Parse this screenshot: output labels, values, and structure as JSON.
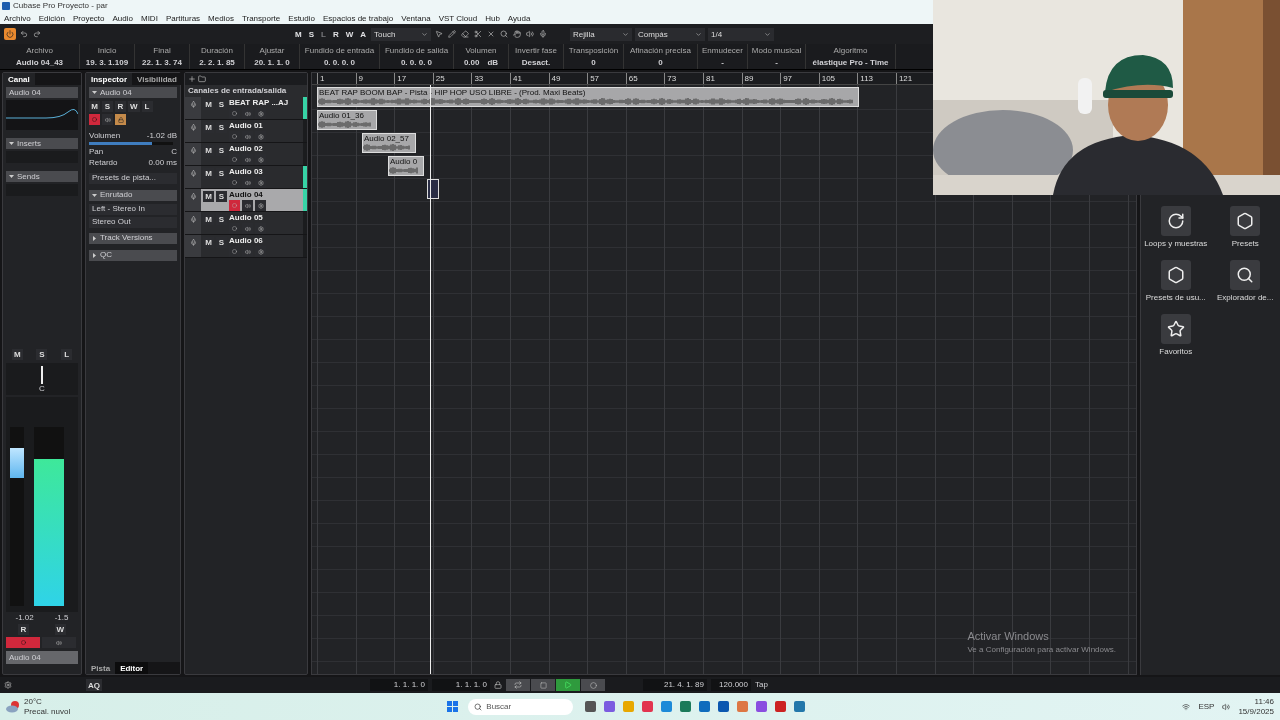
{
  "window": {
    "title": "Cubase Pro Proyecto - par"
  },
  "menu": [
    "Archivo",
    "Edición",
    "Proyecto",
    "Audio",
    "MIDI",
    "Partituras",
    "Medios",
    "Transporte",
    "Estudio",
    "Espacios de trabajo",
    "Ventana",
    "VST Cloud",
    "Hub",
    "Ayuda"
  ],
  "toolbar": {
    "mode_buttons": [
      {
        "label": "M",
        "disabled": false
      },
      {
        "label": "S",
        "disabled": false
      },
      {
        "label": "L",
        "disabled": true
      },
      {
        "label": "R",
        "disabled": false
      },
      {
        "label": "W",
        "disabled": false
      },
      {
        "label": "A",
        "disabled": false
      }
    ],
    "automation_mode": "Touch",
    "snap_type": "Rejilla",
    "grid_type": "Compás",
    "quantize": "1/4"
  },
  "info_line": [
    {
      "label": "Archivo",
      "value": "Audio 04_43"
    },
    {
      "label": "Inicio",
      "value": "19. 3. 1.109"
    },
    {
      "label": "Final",
      "value": "22. 1. 3. 74"
    },
    {
      "label": "Duración",
      "value": "2. 2. 1. 85"
    },
    {
      "label": "Ajustar",
      "value": "20. 1. 1. 0"
    },
    {
      "label": "Fundido de entrada",
      "value": "0. 0. 0. 0"
    },
    {
      "label": "Fundido de salida",
      "value": "0. 0. 0. 0"
    },
    {
      "label": "Volumen",
      "value": "0.00",
      "unit": "dB"
    },
    {
      "label": "Invertir fase",
      "value": "Desact."
    },
    {
      "label": "Transposición",
      "value": "0"
    },
    {
      "label": "Afinación precisa",
      "value": "0"
    },
    {
      "label": "Enmudecer",
      "value": "-"
    },
    {
      "label": "Modo musical",
      "value": "-"
    },
    {
      "label": "Algoritmo",
      "value": "élastique Pro - Time"
    }
  ],
  "channel": {
    "tab": "Canal",
    "name": "Audio 04",
    "sections": [
      "Inserts",
      "Sends"
    ],
    "buttons": [
      "M",
      "S",
      "L"
    ],
    "pan": "C",
    "fader": {
      "level": 0.8
    },
    "meter": {
      "level": 0.82
    },
    "readings": [
      "-1.02",
      "-1.5"
    ],
    "mode_buttons": [
      "R",
      "W"
    ],
    "record_armed": true,
    "footer_name": "Audio 04"
  },
  "inspector": {
    "tabs": [
      {
        "label": "Inspector",
        "selected": true
      },
      {
        "label": "Visibilidad",
        "selected": false
      }
    ],
    "track": "Audio 04",
    "buttons": [
      "M",
      "S",
      "R",
      "W",
      "L"
    ],
    "record_armed": true,
    "volume": {
      "label": "Volumen",
      "value": "-1.02 dB",
      "level": 0.75
    },
    "pan": {
      "label": "Pan",
      "value": "C"
    },
    "delay": {
      "label": "Retardo",
      "value": "0.00 ms"
    },
    "track_presets": "Presets de pista...",
    "sections": [
      {
        "title": "Enrutado",
        "expanded": true,
        "items": [
          "Left - Stereo In",
          "Stereo Out"
        ]
      },
      {
        "title": "Track Versions",
        "expanded": false
      },
      {
        "title": "QC",
        "expanded": false
      }
    ]
  },
  "track_list": {
    "folder": "Canales de entrada/salida",
    "tracks": [
      {
        "name": "BEAT RAP ...AJ",
        "buttons": [
          "M",
          "S"
        ],
        "selected": false,
        "record_armed": false,
        "meter": true
      },
      {
        "name": "Audio 01",
        "buttons": [
          "M",
          "S"
        ],
        "selected": false,
        "record_armed": false,
        "meter": false
      },
      {
        "name": "Audio 02",
        "buttons": [
          "M",
          "S"
        ],
        "selected": false,
        "record_armed": false,
        "meter": false
      },
      {
        "name": "Audio 03",
        "buttons": [
          "M",
          "S"
        ],
        "selected": false,
        "record_armed": false,
        "meter": true
      },
      {
        "name": "Audio 04",
        "buttons": [
          "M",
          "S"
        ],
        "selected": true,
        "record_armed": true,
        "meter": true
      },
      {
        "name": "Audio 05",
        "buttons": [
          "M",
          "S"
        ],
        "selected": false,
        "record_armed": false,
        "meter": false
      },
      {
        "name": "Audio 06",
        "buttons": [
          "M",
          "S"
        ],
        "selected": false,
        "record_armed": false,
        "meter": false
      }
    ]
  },
  "ruler": [
    "1",
    "9",
    "17",
    "25",
    "33",
    "41",
    "49",
    "57",
    "65",
    "73",
    "81",
    "89",
    "97",
    "105",
    "113",
    "121"
  ],
  "events": [
    {
      "kind": "audio",
      "label": "BEAT RAP BOOM BAP - Pista - HIP HOP USO LIBRE - (Prod. Maxi Beats)"
    },
    {
      "kind": "audio",
      "label": "Audio 01_36"
    },
    {
      "kind": "audio",
      "label": "Audio 02_57"
    },
    {
      "kind": "audio",
      "label": "Audio 0"
    },
    {
      "kind": "recording"
    }
  ],
  "bottom_tabs": [
    {
      "label": "Pista",
      "selected": false
    },
    {
      "label": "Editor",
      "selected": true
    }
  ],
  "media": [
    {
      "label": "Loops y muestras"
    },
    {
      "label": "Presets"
    },
    {
      "label": "Presets de usu..."
    },
    {
      "label": "Explorador de..."
    },
    {
      "label": "Favoritos"
    }
  ],
  "activation_notice": {
    "title": "Activar Windows",
    "text": "Ve a Configuración para activar Windows."
  },
  "status_button": "AQ",
  "transport": {
    "left_locator": "1. 1. 1. 0",
    "right_locator": "1. 1. 1. 0",
    "playing": true,
    "position": "21. 4. 1. 89",
    "tempo": "120.000",
    "tap": "Tap"
  },
  "taskbar": {
    "temperature": "20°C",
    "weather": "Precal. nuvol",
    "search_placeholder": "Buscar",
    "language": "ESP",
    "time": "11:46",
    "date": "15/9/2025"
  }
}
